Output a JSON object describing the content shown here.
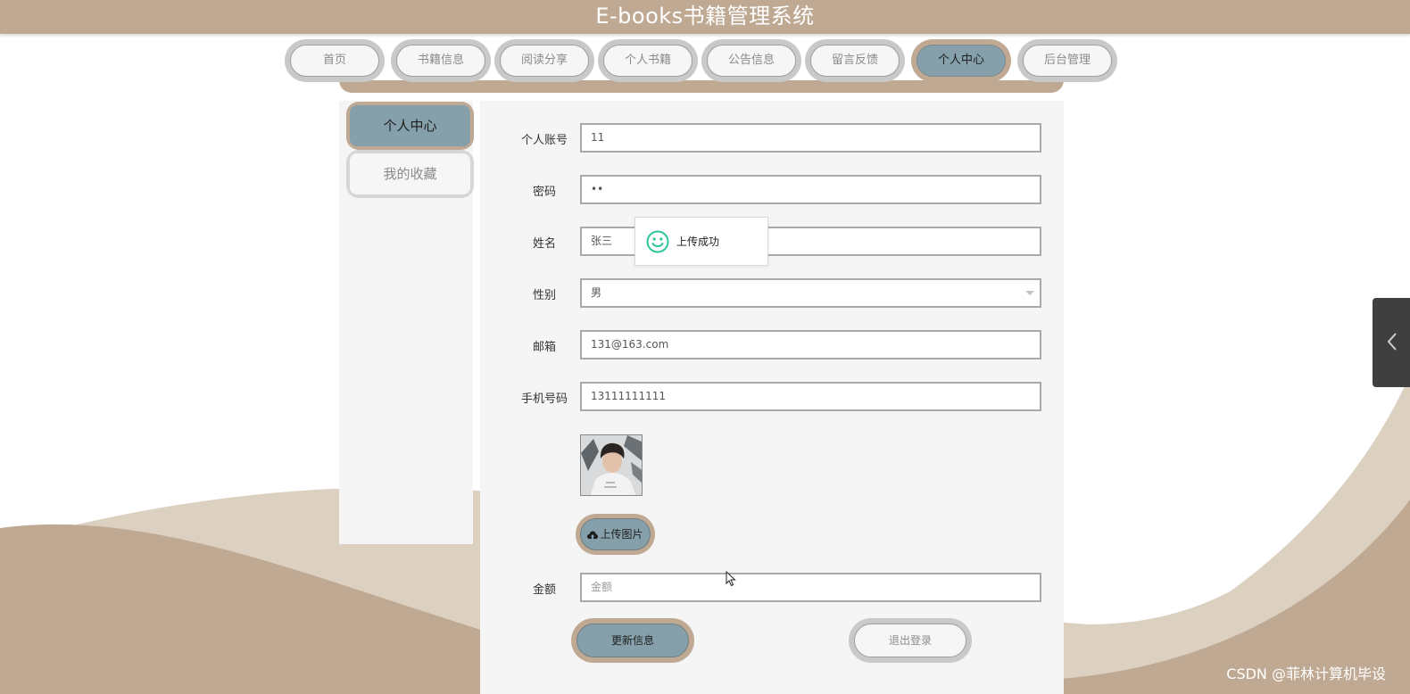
{
  "app": {
    "title": "E-books书籍管理系统"
  },
  "nav": {
    "items": [
      {
        "label": "首页",
        "active": false
      },
      {
        "label": "书籍信息",
        "active": false
      },
      {
        "label": "阅读分享",
        "active": false
      },
      {
        "label": "个人书籍",
        "active": false
      },
      {
        "label": "公告信息",
        "active": false
      },
      {
        "label": "留言反馈",
        "active": false
      },
      {
        "label": "个人中心",
        "active": true
      },
      {
        "label": "后台管理",
        "active": false
      }
    ]
  },
  "sidebar": {
    "items": [
      {
        "label": "个人中心",
        "active": true
      },
      {
        "label": "我的收藏",
        "active": false
      }
    ]
  },
  "form": {
    "account": {
      "label": "个人账号",
      "value": "11"
    },
    "password": {
      "label": "密码",
      "value": "••"
    },
    "name": {
      "label": "姓名",
      "value": "张三"
    },
    "gender": {
      "label": "性别",
      "value": "男"
    },
    "email": {
      "label": "邮箱",
      "value": "131@163.com"
    },
    "phone": {
      "label": "手机号码",
      "value": "13111111111"
    },
    "upload_label": "上传图片",
    "amount": {
      "label": "金额",
      "placeholder": "金额"
    },
    "update_label": "更新信息",
    "logout_label": "退出登录"
  },
  "toast": {
    "text": "上传成功",
    "icon": "smile-icon"
  },
  "watermark": "CSDN @菲林计算机毕设",
  "colors": {
    "brand": "#bfa993",
    "active": "#85a0aa",
    "wave_light": "#dcd0c1",
    "wave_dark": "#bfa993",
    "toast_icon": "#2ec69b"
  }
}
